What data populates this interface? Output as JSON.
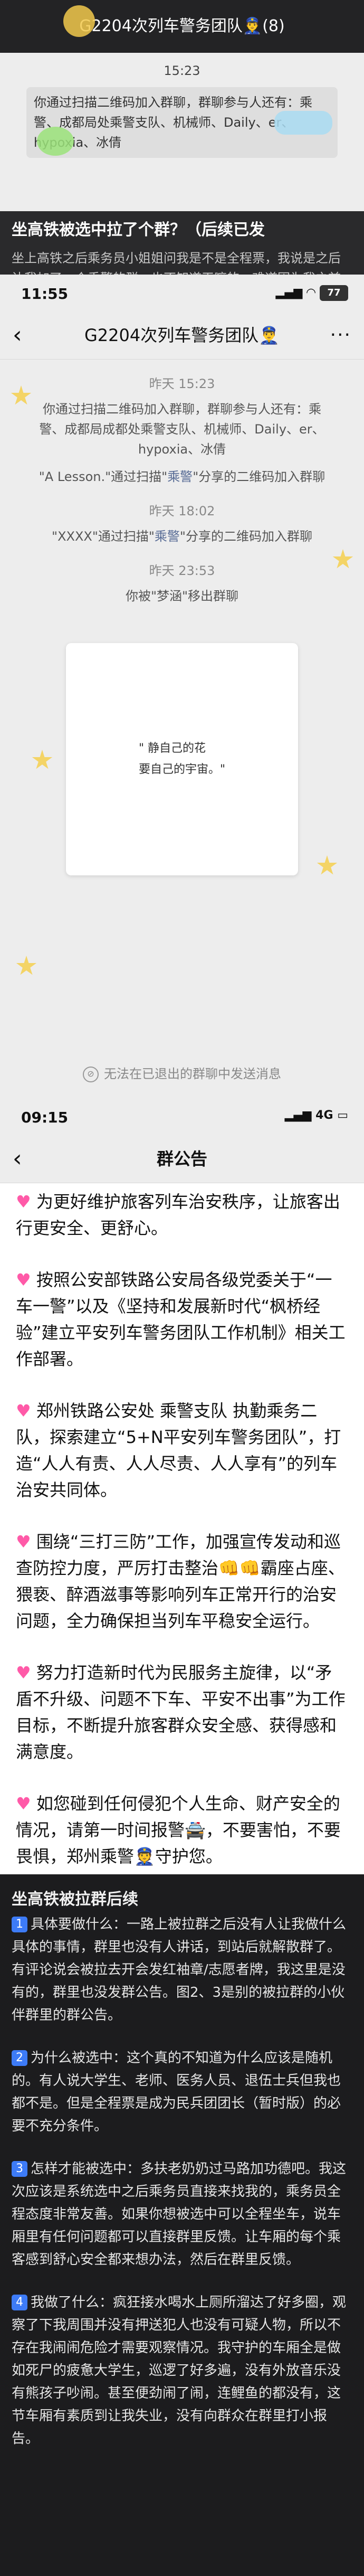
{
  "s1": {
    "header_title": "G2204次列车警务团队👮‍♂️(8)",
    "time": "15:23",
    "sys_msg": "你通过扫描二维码加入群聊，群聊参与人还有：乘警、成都局处乘警支队、机械师、Daily、er、hypoxia、冰倩",
    "caption_title": "坐高铁被选中拉了个群？（后续已发",
    "caption_body": "坐上高铁之后乘务员小姐姐问我是不是全程票，我说是之后让我加了一个乘警的群。也不知道干嘛的，难道因为我之前投诉过瓶孩子被标记为重点旅客了？😂"
  },
  "s2": {
    "clock": "11:55",
    "battery": "77",
    "title": "G2204次列车警务团队👮‍♂️",
    "t1": "昨天 15:23",
    "m1": "你通过扫描二维码加入群聊，群聊参与人还有：乘警、成都局成都处乘警支队、机械师、Daily、er、hypoxia、冰倩",
    "m2_a": "\"A Lesson.\"通过扫描\"",
    "m2_link": "乘警",
    "m2_b": "\"分享的二维码加入群聊",
    "t2": "昨天 18:02",
    "m3_a": "\"XXXX\"通过扫描\"",
    "m3_link": "乘警",
    "m3_b": "\"分享的二维码加入群聊",
    "t3": "昨天 23:53",
    "m4": "你被\"梦涵\"移出群聊",
    "card_line1": "\" 静自己的花",
    "card_line2": "  要自己的宇宙。\"",
    "footer": "无法在已退出的群聊中发送消息"
  },
  "s3": {
    "clock": "09:15",
    "signal": "4G",
    "title": "群公告",
    "p1": "为更好维护旅客列车治安秩序，让旅客出行更安全、更舒心。",
    "p2": "按照公安部铁路公安局各级党委关于“一车一警”以及《坚持和发展新时代“枫桥经验”建立平安列车警务团队工作机制》相关工作部署。",
    "p3": "郑州铁路公安处 乘警支队 执勤乘务二队，探索建立“5+N平安列车警务团队”，打造“人人有责、人人尽责、人人享有”的列车治安共同体。",
    "p4": "围绕“三打三防”工作，加强宣传发动和巡查防控力度，严厉打击整治👊👊霸座占座、猥亵、醉酒滋事等影响列车正常开行的治安问题，全力确保担当列车平稳安全运行。",
    "p5": "努力打造新时代为民服务主旋律，以“矛盾不升级、问题不下车、平安不出事”为工作目标，不断提升旅客群众安全感、获得感和满意度。",
    "p6": "如您碰到任何侵犯个人生命、财产安全的情况，请第一时间报警🚔，不要害怕，不要畏惧，郑州乘警👮守护您。"
  },
  "s4": {
    "head": "坐高铁被拉群后续",
    "b1": "1",
    "para1": "具体要做什么：一路上被拉群之后没有人让我做什么具体的事情，群里也没有人讲话，到站后就解散群了。有评论说会被拉去开会发红袖章/志愿者牌，我这里是没有的，群里也没发群公告。图2、3是别的被拉群的小伙伴群里的群公告。",
    "b2": "2",
    "para2": "为什么被选中：这个真的不知道为什么应该是随机的。有人说大学生、老师、医务人员、退伍士兵但我也都不是。但是全程票是成为民兵团团长（暂时版）的必要不充分条件。",
    "b3": "3",
    "para3": "怎样才能被选中：多扶老奶奶过马路加功德吧。我这次应该是系统选中之后乘务员直接来找我的，乘务员全程态度非常友善。如果你想被选中可以全程坐车，说车厢里有任何问题都可以直接群里反馈。让车厢的每个乘客感到舒心安全都来想办法，然后在群里反馈。",
    "b4": "4",
    "para4": "我做了什么：疯狂接水喝水上厕所溜达了好多圈，观察了下我周围并没有押送犯人也没有可疑人物，所以不存在我闹闹危险才需要观察情况。我守护的车厢全是做如死尸的疲惫大学生，巡逻了好多遍，没有外放音乐没有熊孩子吵闹。甚至便劲闹了闹，连鲤鱼的都没有，这节车厢有素质到让我失业，没有向群众在群里打小报告。"
  }
}
